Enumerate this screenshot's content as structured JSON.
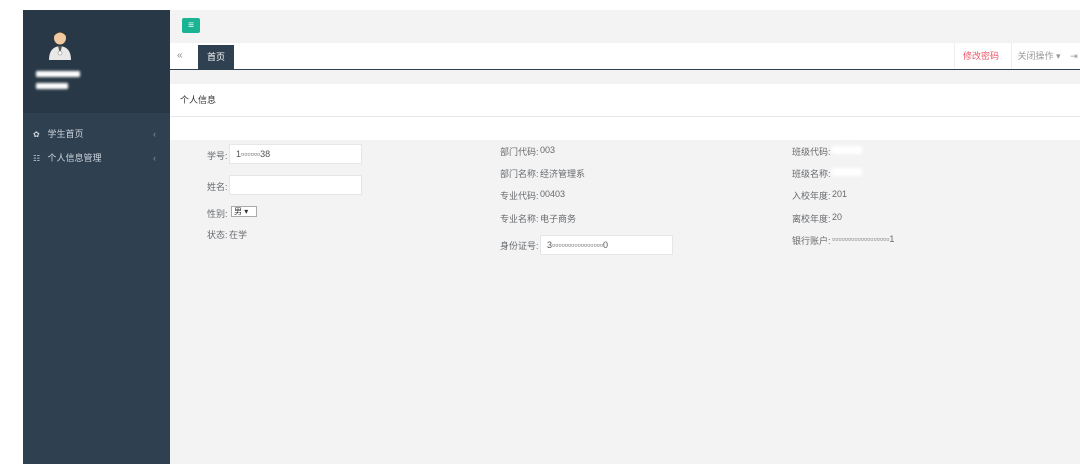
{
  "user": {
    "name": "▬▬▬▬▬▬",
    "class": "▬▬▬▬"
  },
  "sidebar": {
    "items": [
      {
        "label": "学生首页",
        "icon": "home-icon",
        "arrow": "‹"
      },
      {
        "label": "个人信息管理",
        "icon": "list-icon",
        "arrow": "‹"
      }
    ]
  },
  "topbar": {
    "menu_icon": "≡"
  },
  "tabs": {
    "back": "«",
    "active": "首页",
    "change_password": "修改密码",
    "close_ops": "关闭操作 ▾",
    "logout": "⇥"
  },
  "panel": {
    "title": "个人信息"
  },
  "form": {
    "student_id_label": "学号:",
    "student_id_value": "1▫▫▫▫▫▫38",
    "name_label": "姓名:",
    "name_value": "",
    "gender_label": "性别:",
    "gender_value": "男 ▾",
    "status_label": "状态:",
    "status_value": "在学",
    "dept_code_label": "部门代码:",
    "dept_code_value": "003",
    "dept_name_label": "部门名称:",
    "dept_name_value": "经济管理系",
    "major_code_label": "专业代码:",
    "major_code_value": "00403",
    "major_name_label": "专业名称:",
    "major_name_value": "电子商务",
    "id_card_label": "身份证号:",
    "id_card_value": "3▫▫▫▫▫▫▫▫▫▫▫▫▫▫▫▫0",
    "class_code_label": "班级代码:",
    "class_name_label": "班级名称:",
    "enroll_year_label": "入校年度:",
    "enroll_year_value": "201",
    "leave_year_label": "离校年度:",
    "leave_year_value": "20",
    "bank_label": "银行账户:",
    "bank_value": "▫▫▫▫▫▫▫▫▫▫▫▫▫▫▫▫▫▫1"
  },
  "colors": {
    "sidebar": "#2f4050",
    "profile": "#293846",
    "accent": "#1ab394",
    "danger": "#ed5565"
  }
}
